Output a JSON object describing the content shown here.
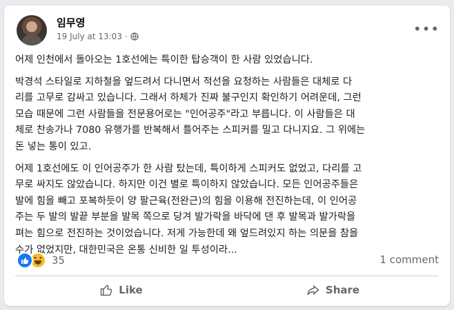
{
  "post": {
    "author": "임무영",
    "timestamp": "19 July at 13:03",
    "dot": "·",
    "audience_icon": "globe-icon",
    "more_icon": "more-options-icon",
    "more_label": "•••",
    "paragraphs": [
      "어제 인천에서 돌아오는 1호선에는 특이한 탑승객이 한 사람 있었습니다.",
      "박경석 스타일로 지하철을 엎드려서 다니면서 적선을 요청하는 사람들은 대체로 다\n리를 고무로 감싸고 있습니다. 그래서 하체가 진짜 불구인지 확인하기 어려운데, 그런\n모습 때문에 그런 사람들을 전문용어로는 \"인어공주\"라고 부릅니다. 이 사람들은 대\n체로 찬송가나 7080 유행가를 반복해서 틀어주는 스피커를 밀고 다니지요. 그 위에는\n돈 넣는 통이 있고.",
      "어제 1호선에도 이 인어공주가 한 사람 탔는데, 특이하게 스피커도 없었고, 다리를 고\n무로 싸지도 않았습니다. 하지만 이건 별로 특이하지 않았습니다. 모든 인어공주들은\n발에 힘을 빼고 포복하듯이 양 팔근육(전완근)의 힘을 이용해 전진하는데, 이 인어공\n주는 두 발의 발끝 부분을 발목 쪽으로 당겨 발가락을 바닥에 댄 후 발목과 발가락을\n펴는 힘으로 전진하는 것이었습니다. 저게 가능한데 왜 엎드려있지 하는 의문을 참을\n수가 없었지만, 대한민국은 온통 신비한 일 투성이라..."
    ]
  },
  "engagement": {
    "reaction_icons": [
      "like-reaction-icon",
      "haha-reaction-icon"
    ],
    "reaction_count": "35",
    "comments": "1 comment"
  },
  "actions": {
    "like_label": "Like",
    "share_label": "Share"
  },
  "colors": {
    "like_blue": "#1877f2",
    "haha_yellow": "#f7b928",
    "secondary_text": "#65676b"
  }
}
